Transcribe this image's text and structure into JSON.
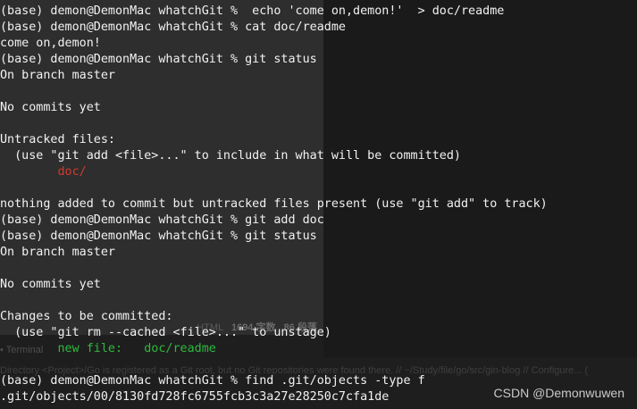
{
  "colors": {
    "background": "#1e1e1e",
    "text": "#f2f2f2",
    "untracked": "#d23a30",
    "staged": "#2fb93e"
  },
  "lines": [
    {
      "text": "(base) demon@DemonMac whatchGit %  echo 'come on,demon!'  > doc/readme",
      "style": "normal"
    },
    {
      "text": "(base) demon@DemonMac whatchGit % cat doc/readme",
      "style": "normal"
    },
    {
      "text": "come on,demon!",
      "style": "normal"
    },
    {
      "text": "(base) demon@DemonMac whatchGit % git status",
      "style": "normal"
    },
    {
      "text": "On branch master",
      "style": "normal"
    },
    {
      "text": "",
      "style": "normal"
    },
    {
      "text": "No commits yet",
      "style": "normal"
    },
    {
      "text": "",
      "style": "normal"
    },
    {
      "text": "Untracked files:",
      "style": "normal"
    },
    {
      "text": "  (use \"git add <file>...\" to include in what will be committed)",
      "style": "normal"
    },
    {
      "text": "        doc/",
      "style": "red"
    },
    {
      "text": "",
      "style": "normal"
    },
    {
      "text": "nothing added to commit but untracked files present (use \"git add\" to track)",
      "style": "normal"
    },
    {
      "text": "(base) demon@DemonMac whatchGit % git add doc",
      "style": "normal"
    },
    {
      "text": "(base) demon@DemonMac whatchGit % git status",
      "style": "normal"
    },
    {
      "text": "On branch master",
      "style": "normal"
    },
    {
      "text": "",
      "style": "normal"
    },
    {
      "text": "No commits yet",
      "style": "normal"
    },
    {
      "text": "",
      "style": "normal"
    },
    {
      "text": "Changes to be committed:",
      "style": "normal"
    },
    {
      "text": "  (use \"git rm --cached <file>...\" to unstage)",
      "style": "normal"
    },
    {
      "text": "        new file:   doc/readme",
      "style": "green"
    },
    {
      "text": "",
      "style": "normal"
    },
    {
      "text": "(base) demon@DemonMac whatchGit % find .git/objects -type f",
      "style": "normal"
    },
    {
      "text": ".git/objects/00/8130fd728fc6755fcb3c3a27e28250c7cfa1de",
      "style": "normal"
    }
  ],
  "ghost_info": {
    "format": "HTML",
    "chars": "1694 字数",
    "paragraphs": "86 段落"
  },
  "ghost_terminal_label": "Terminal",
  "ghost_status": "Directory <Project>/Go is registered as a Git root, but no Git repositories were found there. // ~/Study/file/go/src/gin-blog // Configure... (",
  "watermark": "CSDN @Demonwuwen"
}
